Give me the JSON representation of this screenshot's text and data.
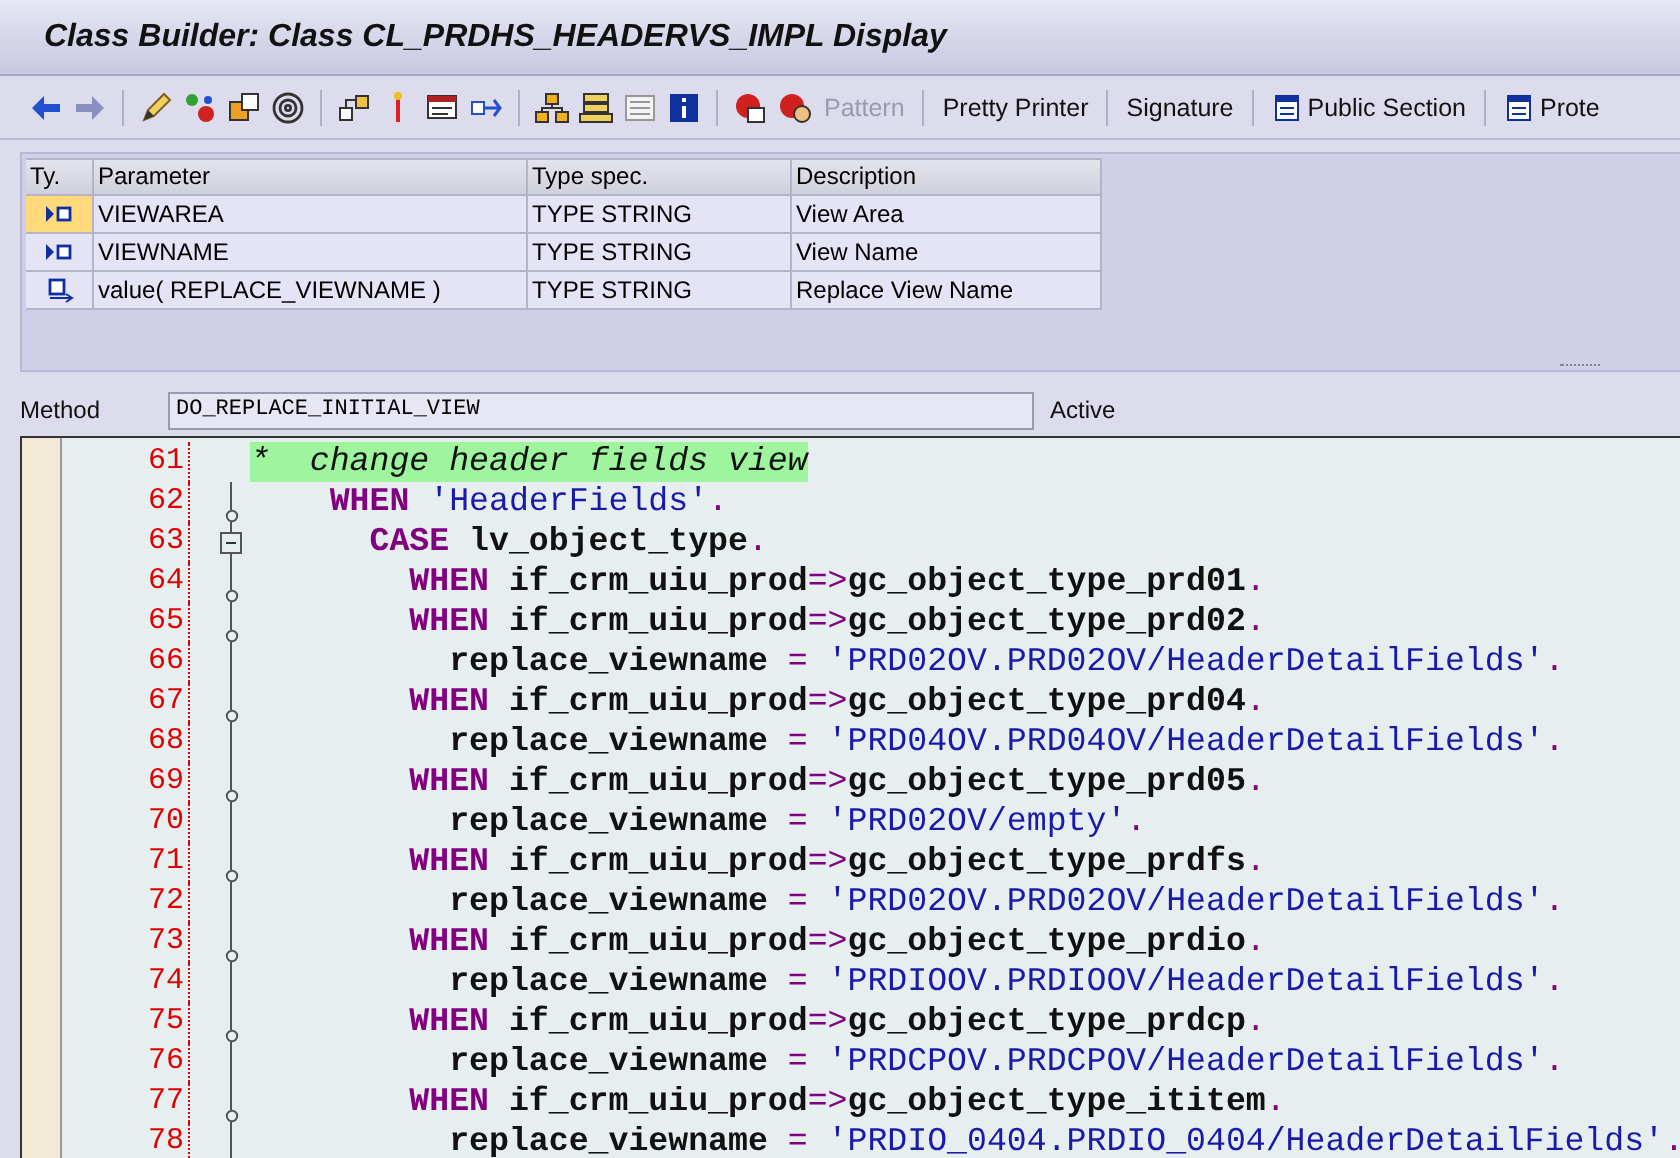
{
  "window": {
    "title": "Class Builder: Class CL_PRDHS_HEADERVS_IMPL Display"
  },
  "toolbar": {
    "buttons": [
      {
        "label": "Pattern",
        "disabled": true,
        "icon": false
      },
      {
        "label": "Pretty Printer",
        "disabled": false,
        "icon": false
      },
      {
        "label": "Signature",
        "disabled": false,
        "icon": false
      },
      {
        "label": "Public Section",
        "disabled": false,
        "icon": true
      },
      {
        "label": "Prote",
        "disabled": false,
        "icon": true
      }
    ]
  },
  "parameters": {
    "columns": [
      "Ty.",
      "Parameter",
      "Type spec.",
      "Description"
    ],
    "rows": [
      {
        "kind": "importing",
        "selected": true,
        "parameter": "VIEWAREA",
        "type_spec": "TYPE STRING",
        "description": "View Area"
      },
      {
        "kind": "importing",
        "selected": false,
        "parameter": "VIEWNAME",
        "type_spec": "TYPE STRING",
        "description": "View Name"
      },
      {
        "kind": "returning",
        "selected": false,
        "parameter": "value( REPLACE_VIEWNAME )",
        "type_spec": "TYPE STRING",
        "description": "Replace View Name"
      }
    ]
  },
  "method": {
    "label": "Method",
    "value": "DO_REPLACE_INITIAL_VIEW",
    "status": "Active"
  },
  "editor": {
    "lines": [
      {
        "number": "61",
        "node": false,
        "collapse_box": false,
        "highlight": true,
        "tokens": [
          {
            "kind": "comment",
            "text": "*  change header fields view"
          }
        ]
      },
      {
        "number": "62",
        "node": true,
        "collapse_box": false,
        "highlight": false,
        "tokens": [
          {
            "kind": "keyword",
            "text": "    WHEN"
          },
          {
            "kind": "string",
            "text": " 'HeaderFields'"
          },
          {
            "kind": "op",
            "text": "."
          }
        ]
      },
      {
        "number": "63",
        "node": false,
        "collapse_box": true,
        "highlight": false,
        "tokens": [
          {
            "kind": "keyword",
            "text": "      CASE"
          },
          {
            "kind": "ident",
            "text": " lv_object_type"
          },
          {
            "kind": "op",
            "text": "."
          }
        ]
      },
      {
        "number": "64",
        "node": true,
        "collapse_box": false,
        "highlight": false,
        "tokens": [
          {
            "kind": "keyword",
            "text": "        WHEN"
          },
          {
            "kind": "ident",
            "text": " if_crm_uiu_prod"
          },
          {
            "kind": "op",
            "text": "=>"
          },
          {
            "kind": "ident",
            "text": "gc_object_type_prd01"
          },
          {
            "kind": "op",
            "text": "."
          }
        ]
      },
      {
        "number": "65",
        "node": true,
        "collapse_box": false,
        "highlight": false,
        "tokens": [
          {
            "kind": "keyword",
            "text": "        WHEN"
          },
          {
            "kind": "ident",
            "text": " if_crm_uiu_prod"
          },
          {
            "kind": "op",
            "text": "=>"
          },
          {
            "kind": "ident",
            "text": "gc_object_type_prd02"
          },
          {
            "kind": "op",
            "text": "."
          }
        ]
      },
      {
        "number": "66",
        "node": false,
        "collapse_box": false,
        "highlight": false,
        "tokens": [
          {
            "kind": "ident",
            "text": "          replace_viewname"
          },
          {
            "kind": "op",
            "text": " = "
          },
          {
            "kind": "string",
            "text": "'PRD02OV.PRD02OV/HeaderDetailFields'"
          },
          {
            "kind": "op",
            "text": "."
          }
        ]
      },
      {
        "number": "67",
        "node": true,
        "collapse_box": false,
        "highlight": false,
        "tokens": [
          {
            "kind": "keyword",
            "text": "        WHEN"
          },
          {
            "kind": "ident",
            "text": " if_crm_uiu_prod"
          },
          {
            "kind": "op",
            "text": "=>"
          },
          {
            "kind": "ident",
            "text": "gc_object_type_prd04"
          },
          {
            "kind": "op",
            "text": "."
          }
        ]
      },
      {
        "number": "68",
        "node": false,
        "collapse_box": false,
        "highlight": false,
        "tokens": [
          {
            "kind": "ident",
            "text": "          replace_viewname"
          },
          {
            "kind": "op",
            "text": " = "
          },
          {
            "kind": "string",
            "text": "'PRD04OV.PRD04OV/HeaderDetailFields'"
          },
          {
            "kind": "op",
            "text": "."
          }
        ]
      },
      {
        "number": "69",
        "node": true,
        "collapse_box": false,
        "highlight": false,
        "tokens": [
          {
            "kind": "keyword",
            "text": "        WHEN"
          },
          {
            "kind": "ident",
            "text": " if_crm_uiu_prod"
          },
          {
            "kind": "op",
            "text": "=>"
          },
          {
            "kind": "ident",
            "text": "gc_object_type_prd05"
          },
          {
            "kind": "op",
            "text": "."
          }
        ]
      },
      {
        "number": "70",
        "node": false,
        "collapse_box": false,
        "highlight": false,
        "tokens": [
          {
            "kind": "ident",
            "text": "          replace_viewname"
          },
          {
            "kind": "op",
            "text": " = "
          },
          {
            "kind": "string",
            "text": "'PRD02OV/empty'"
          },
          {
            "kind": "op",
            "text": "."
          }
        ]
      },
      {
        "number": "71",
        "node": true,
        "collapse_box": false,
        "highlight": false,
        "tokens": [
          {
            "kind": "keyword",
            "text": "        WHEN"
          },
          {
            "kind": "ident",
            "text": " if_crm_uiu_prod"
          },
          {
            "kind": "op",
            "text": "=>"
          },
          {
            "kind": "ident",
            "text": "gc_object_type_prdfs"
          },
          {
            "kind": "op",
            "text": "."
          }
        ]
      },
      {
        "number": "72",
        "node": false,
        "collapse_box": false,
        "highlight": false,
        "tokens": [
          {
            "kind": "ident",
            "text": "          replace_viewname"
          },
          {
            "kind": "op",
            "text": " = "
          },
          {
            "kind": "string",
            "text": "'PRD02OV.PRD02OV/HeaderDetailFields'"
          },
          {
            "kind": "op",
            "text": "."
          }
        ]
      },
      {
        "number": "73",
        "node": true,
        "collapse_box": false,
        "highlight": false,
        "tokens": [
          {
            "kind": "keyword",
            "text": "        WHEN"
          },
          {
            "kind": "ident",
            "text": " if_crm_uiu_prod"
          },
          {
            "kind": "op",
            "text": "=>"
          },
          {
            "kind": "ident",
            "text": "gc_object_type_prdio"
          },
          {
            "kind": "op",
            "text": "."
          }
        ]
      },
      {
        "number": "74",
        "node": false,
        "collapse_box": false,
        "highlight": false,
        "tokens": [
          {
            "kind": "ident",
            "text": "          replace_viewname"
          },
          {
            "kind": "op",
            "text": " = "
          },
          {
            "kind": "string",
            "text": "'PRDIOOV.PRDIOOV/HeaderDetailFields'"
          },
          {
            "kind": "op",
            "text": "."
          }
        ]
      },
      {
        "number": "75",
        "node": true,
        "collapse_box": false,
        "highlight": false,
        "tokens": [
          {
            "kind": "keyword",
            "text": "        WHEN"
          },
          {
            "kind": "ident",
            "text": " if_crm_uiu_prod"
          },
          {
            "kind": "op",
            "text": "=>"
          },
          {
            "kind": "ident",
            "text": "gc_object_type_prdcp"
          },
          {
            "kind": "op",
            "text": "."
          }
        ]
      },
      {
        "number": "76",
        "node": false,
        "collapse_box": false,
        "highlight": false,
        "tokens": [
          {
            "kind": "ident",
            "text": "          replace_viewname"
          },
          {
            "kind": "op",
            "text": " = "
          },
          {
            "kind": "string",
            "text": "'PRDCPOV.PRDCPOV/HeaderDetailFields'"
          },
          {
            "kind": "op",
            "text": "."
          }
        ]
      },
      {
        "number": "77",
        "node": true,
        "collapse_box": false,
        "highlight": false,
        "tokens": [
          {
            "kind": "keyword",
            "text": "        WHEN"
          },
          {
            "kind": "ident",
            "text": " if_crm_uiu_prod"
          },
          {
            "kind": "op",
            "text": "=>"
          },
          {
            "kind": "ident",
            "text": "gc_object_type_ititem"
          },
          {
            "kind": "op",
            "text": "."
          }
        ]
      },
      {
        "number": "78",
        "node": false,
        "collapse_box": false,
        "highlight": false,
        "tokens": [
          {
            "kind": "ident",
            "text": "          replace_viewname"
          },
          {
            "kind": "op",
            "text": " = "
          },
          {
            "kind": "string",
            "text": "'PRDIO_0404.PRDIO_0404/HeaderDetailFields'"
          },
          {
            "kind": "op",
            "text": "."
          }
        ]
      }
    ]
  }
}
